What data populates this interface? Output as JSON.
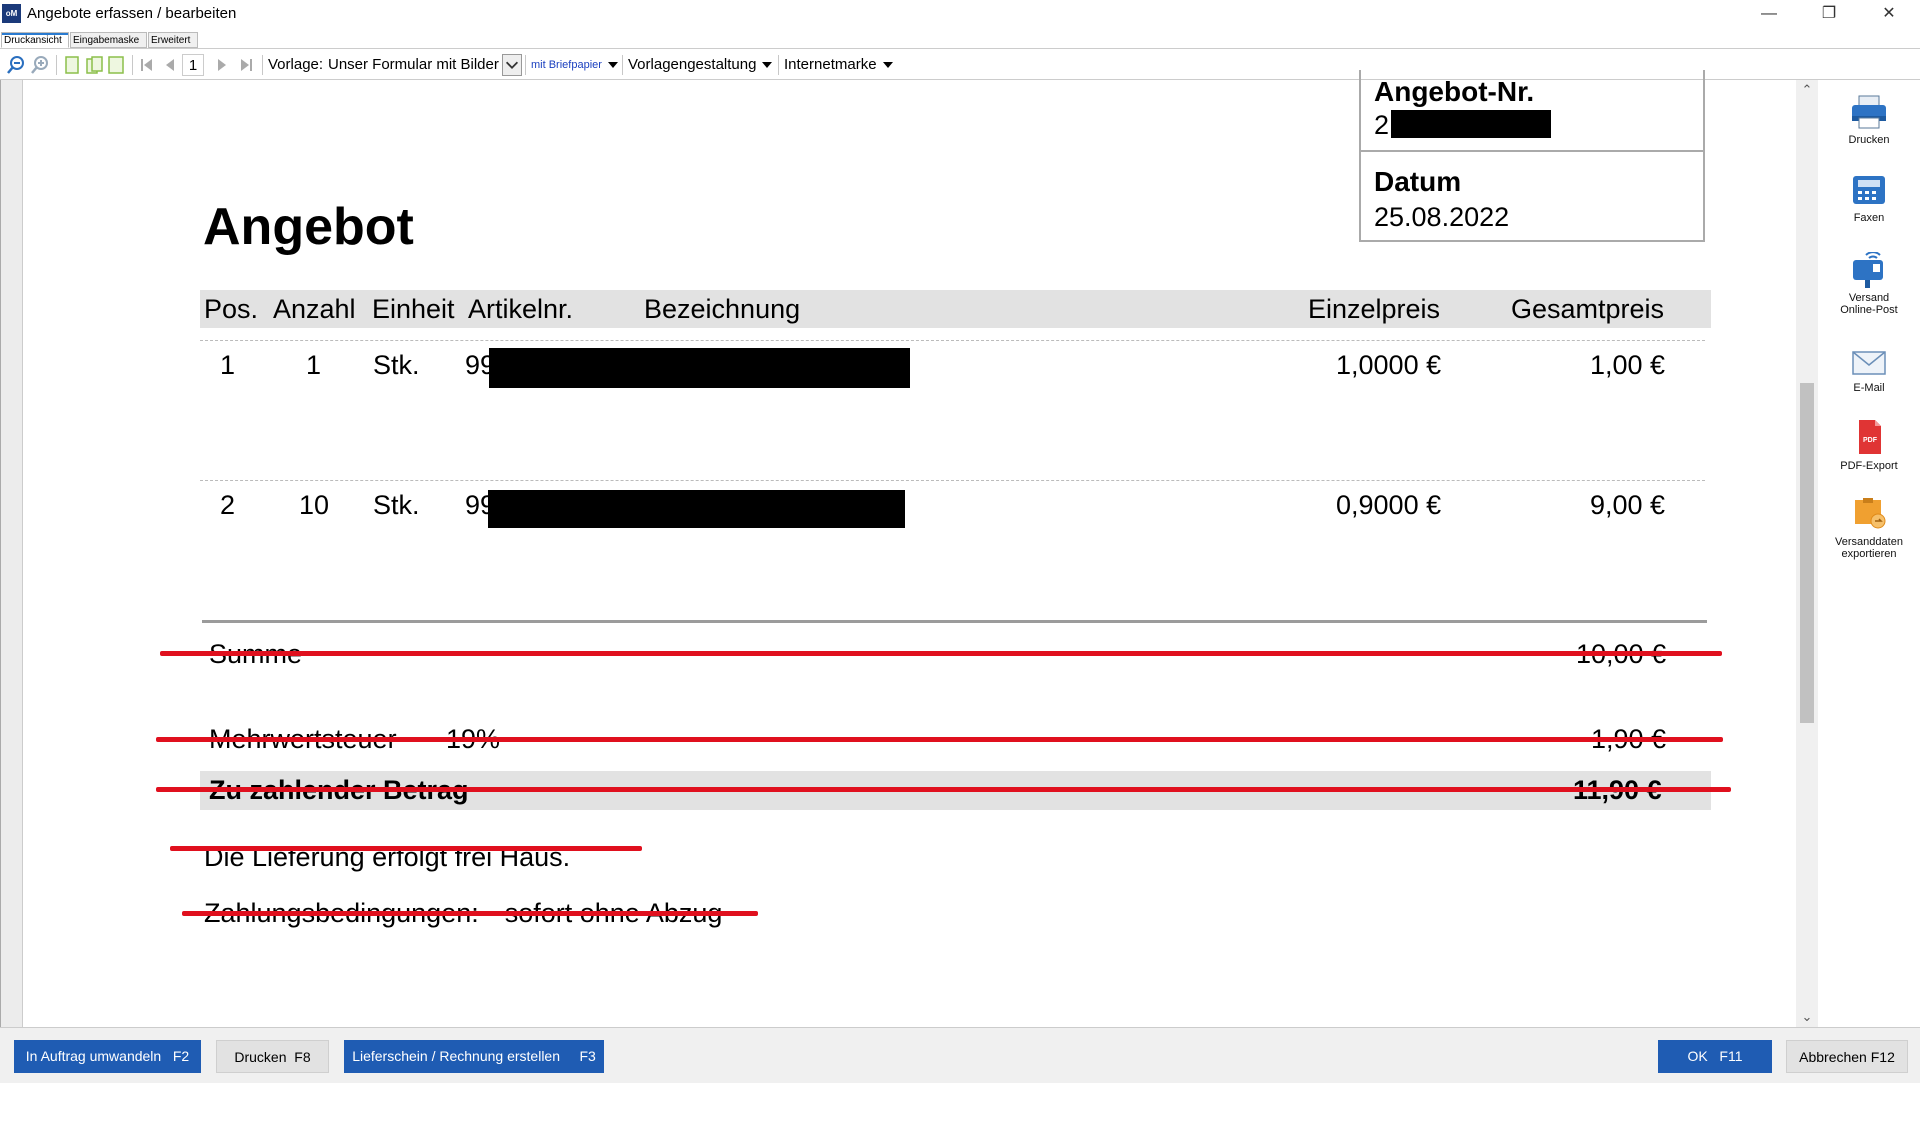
{
  "window": {
    "title": "Angebote erfassen / bearbeiten",
    "app_icon_text": "oM",
    "controls": [
      "minimize-icon",
      "restore-icon",
      "close-icon"
    ]
  },
  "tabs": [
    {
      "label": "Druckansicht",
      "active": true
    },
    {
      "label": "Eingabemaske",
      "active": false
    },
    {
      "label": "Erweitert",
      "active": false
    }
  ],
  "toolbar": {
    "page_number": "1",
    "template_label": "Vorlage:",
    "template_value": "Unser Formular mit Bilder",
    "letterhead_label": "mit Briefpapier",
    "template_design_label": "Vorlagengestaltung",
    "postage_label": "Internetmarke"
  },
  "document": {
    "title": "Angebot",
    "offer_no_label": "Angebot-Nr.",
    "offer_no_value": "2",
    "date_label": "Datum",
    "date_value": "25.08.2022",
    "columns": [
      "Pos.",
      "Anzahl",
      "Einheit",
      "Artikelnr.",
      "Bezeichnung",
      "Einzelpreis",
      "Gesamtpreis"
    ],
    "items": [
      {
        "pos": "1",
        "qty": "1",
        "unit": "Stk.",
        "article": "99",
        "unit_price": "1,0000 €",
        "total": "1,00 €"
      },
      {
        "pos": "2",
        "qty": "10",
        "unit": "Stk.",
        "article": "99",
        "unit_price": "0,9000 €",
        "total": "9,00 €"
      }
    ],
    "sum_label": "Summe",
    "sum_value": "10,00 €",
    "vat_label": "Mehrwertsteuer",
    "vat_rate": "19%",
    "vat_value": "1,90 €",
    "total_label": "Zu zahlender Betrag",
    "total_value": "11,90 €",
    "delivery_note": "Die Lieferung erfolgt frei Haus.",
    "payment_label": "Zahlungsbedingungen:",
    "payment_value": "sofort ohne Abzug"
  },
  "side_actions": [
    {
      "label": "Drucken",
      "icon": "printer-icon"
    },
    {
      "label": "Faxen",
      "icon": "fax-icon"
    },
    {
      "label": "Versand",
      "label2": "Online-Post",
      "icon": "online-post-icon"
    },
    {
      "label": "E-Mail",
      "icon": "email-icon"
    },
    {
      "label": "PDF-Export",
      "icon": "pdf-icon"
    },
    {
      "label": "Versanddaten",
      "label2": "exportieren",
      "icon": "shipping-export-icon"
    }
  ],
  "bottom_buttons": {
    "convert": "In Auftrag umwandeln",
    "convert_key": "F2",
    "print": "Drucken",
    "print_key": "F8",
    "delivery": "Lieferschein / Rechnung erstellen",
    "delivery_key": "F3",
    "ok": "OK",
    "ok_key": "F11",
    "cancel": "Abbrechen",
    "cancel_key": "F12"
  },
  "colors": {
    "primary_button": "#1f5cb3",
    "strike": "#e0101e",
    "table_header": "#e2e2e2"
  }
}
